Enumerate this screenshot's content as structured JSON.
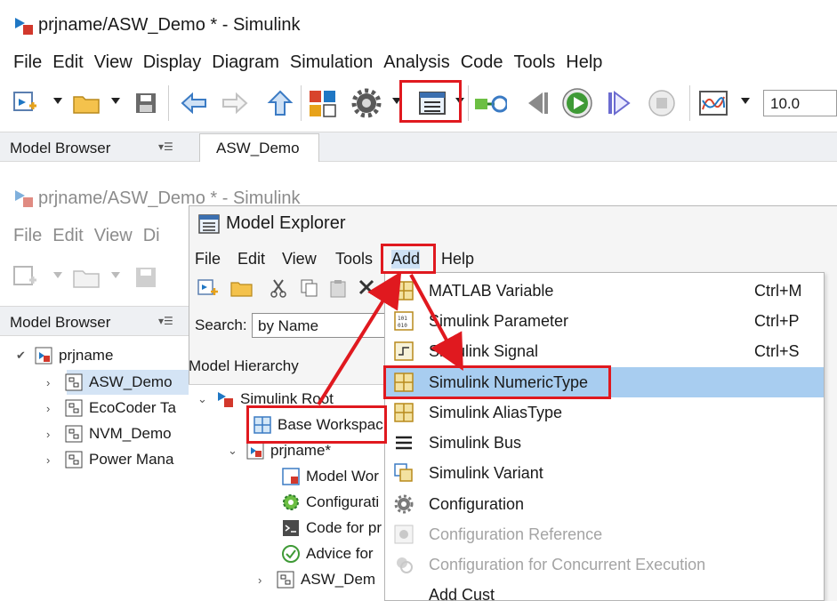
{
  "top_window": {
    "title": "prjname/ASW_Demo * - Simulink",
    "menu": [
      "File",
      "Edit",
      "View",
      "Display",
      "Diagram",
      "Simulation",
      "Analysis",
      "Code",
      "Tools",
      "Help"
    ],
    "stop_time": "10.0",
    "model_browser_label": "Model Browser",
    "tab_label": "ASW_Demo"
  },
  "second_window": {
    "title": "prjname/ASW_Demo * - Simulink",
    "menu": [
      "File",
      "Edit",
      "View",
      "Di"
    ],
    "model_browser_label": "Model Browser",
    "tree": [
      {
        "label": "prjname"
      },
      {
        "label": "ASW_Demo"
      },
      {
        "label": "EcoCoder Ta"
      },
      {
        "label": "NVM_Demo"
      },
      {
        "label": "Power Mana"
      }
    ]
  },
  "model_explorer": {
    "title": "Model Explorer",
    "menu": [
      "File",
      "Edit",
      "View",
      "Tools",
      "Add",
      "Help"
    ],
    "search_label": "Search:",
    "search_value": "by Name",
    "hierarchy_header": "Model Hierarchy",
    "hierarchy": [
      {
        "label": "Simulink Root"
      },
      {
        "label": "Base Workspac"
      },
      {
        "label": "prjname*"
      },
      {
        "label": "Model Wor"
      },
      {
        "label": "Configurati"
      },
      {
        "label": "Code for pr"
      },
      {
        "label": "Advice for"
      },
      {
        "label": "ASW_Dem"
      }
    ],
    "add_menu": [
      {
        "label": "MATLAB Variable",
        "shortcut": "Ctrl+M"
      },
      {
        "label": "Simulink Parameter",
        "shortcut": "Ctrl+P"
      },
      {
        "label": "Simulink Signal",
        "shortcut": "Ctrl+S"
      },
      {
        "label": "Simulink NumericType",
        "shortcut": ""
      },
      {
        "label": "Simulink AliasType",
        "shortcut": ""
      },
      {
        "label": "Simulink Bus",
        "shortcut": ""
      },
      {
        "label": "Simulink Variant",
        "shortcut": ""
      },
      {
        "label": "Configuration",
        "shortcut": ""
      },
      {
        "label": "Configuration Reference",
        "shortcut": ""
      },
      {
        "label": "Configuration for Concurrent Execution",
        "shortcut": ""
      },
      {
        "label": "Add Cust",
        "shortcut": ""
      }
    ]
  },
  "colors": {
    "highlight": "#a8cdf0",
    "annotation_red": "#e0191f",
    "disabled_text": "#a4a4a4"
  }
}
